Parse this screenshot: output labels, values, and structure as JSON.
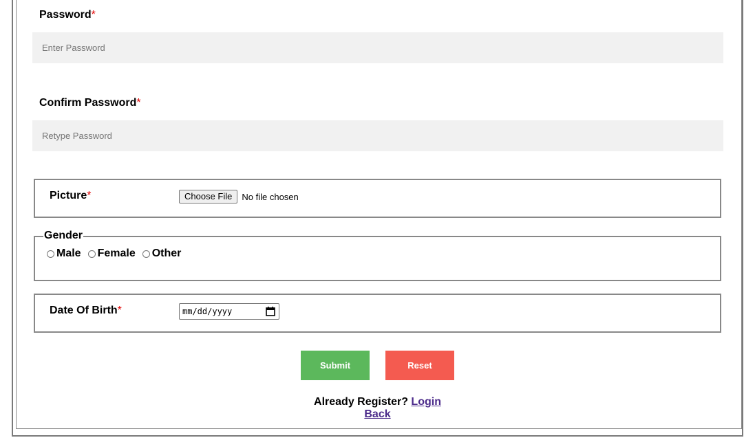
{
  "password": {
    "label": "Password",
    "required_mark": "*",
    "placeholder": "Enter Password"
  },
  "confirm_password": {
    "label": "Confirm Password",
    "required_mark": "*",
    "placeholder": "Retype Password"
  },
  "picture": {
    "label": "Picture",
    "required_mark": "*",
    "button_label": "Choose File",
    "status_text": "No file chosen"
  },
  "gender": {
    "legend": "Gender",
    "options": [
      "Male",
      "Female",
      "Other"
    ]
  },
  "dob": {
    "label": "Date Of Birth",
    "required_mark": "*",
    "placeholder": "mm/dd/yyyy"
  },
  "actions": {
    "submit_label": "Submit",
    "reset_label": "Reset",
    "submit_color": "#5cb85c",
    "reset_color": "#f45b50"
  },
  "footer": {
    "already_text": "Already Register?",
    "login_link": "Login",
    "back_link": "Back"
  }
}
